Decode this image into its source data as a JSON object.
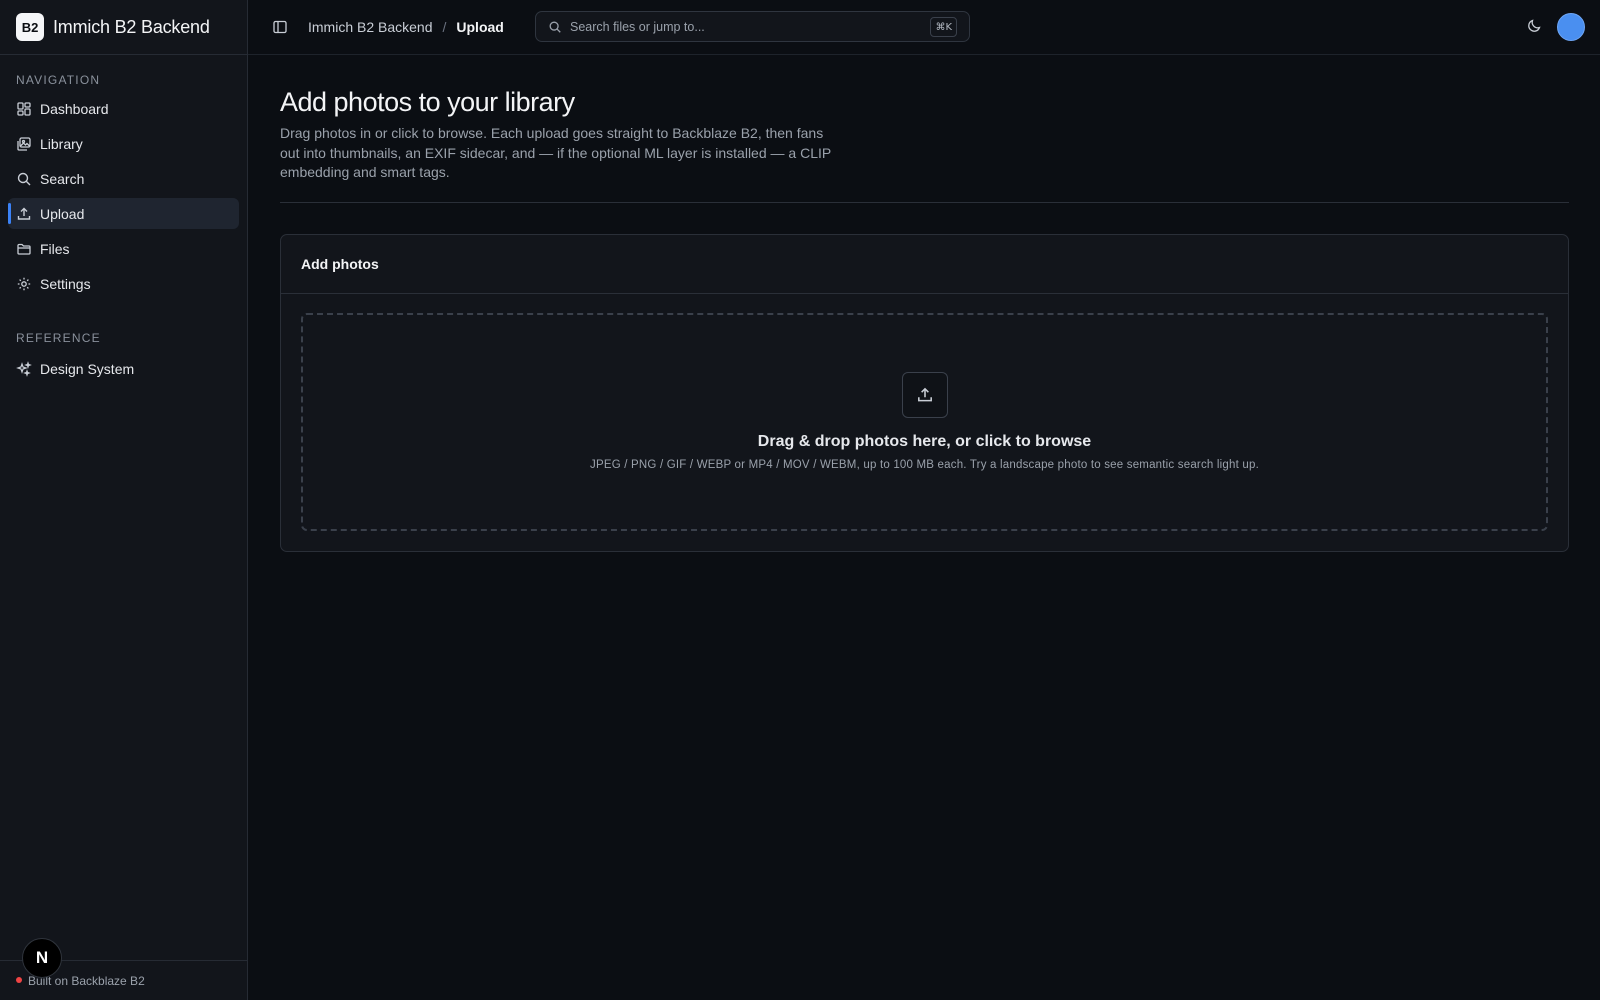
{
  "app": {
    "logo_text": "B2",
    "title": "Immich B2 Backend"
  },
  "sidebar": {
    "nav_label": "NAVIGATION",
    "items": [
      {
        "label": "Dashboard",
        "icon": "dashboard-icon"
      },
      {
        "label": "Library",
        "icon": "library-icon"
      },
      {
        "label": "Search",
        "icon": "search-icon"
      },
      {
        "label": "Upload",
        "icon": "upload-icon",
        "active": true
      },
      {
        "label": "Files",
        "icon": "folder-icon"
      },
      {
        "label": "Settings",
        "icon": "gear-icon"
      }
    ],
    "reference_label": "REFERENCE",
    "reference_items": [
      {
        "label": "Design System",
        "icon": "sparkles-icon"
      }
    ],
    "footer_text": "Built on Backblaze B2",
    "badge_letter": "N"
  },
  "header": {
    "breadcrumb_root": "Immich B2 Backend",
    "breadcrumb_sep": "/",
    "breadcrumb_current": "Upload",
    "search_placeholder": "Search files or jump to...",
    "search_shortcut": "⌘K"
  },
  "main": {
    "title": "Add photos to your library",
    "description": "Drag photos in or click to browse. Each upload goes straight to Backblaze B2, then fans out into thumbnails, an EXIF sidecar, and — if the optional ML layer is installed — a CLIP embedding and smart tags.",
    "card_title": "Add photos",
    "dropzone_title": "Drag & drop photos here, or click to browse",
    "dropzone_subtitle": "JPEG / PNG / GIF / WEBP or MP4 / MOV / WEBM, up to 100 MB each. Try a landscape photo to see semantic search light up."
  },
  "colors": {
    "accent": "#3b82f6",
    "avatar": "#4a8ff0",
    "status_dot": "#ef4444"
  }
}
